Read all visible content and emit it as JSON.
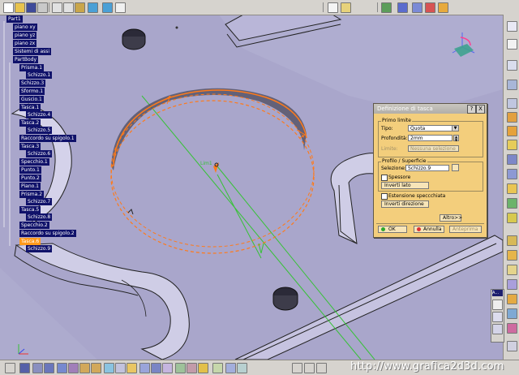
{
  "tree": {
    "nodes": [
      {
        "label": "Part1"
      },
      {
        "label": "piano xy"
      },
      {
        "label": "piano yz"
      },
      {
        "label": "piano zx"
      },
      {
        "label": "Sistemi di assi"
      },
      {
        "label": "PartBody"
      },
      {
        "label": "Prisma.1"
      },
      {
        "label": "Schizzo.1"
      },
      {
        "label": "Schizzo.3"
      },
      {
        "label": "Sformo.1"
      },
      {
        "label": "Guscio.1"
      },
      {
        "label": "Tasca.1"
      },
      {
        "label": "Schizzo.4"
      },
      {
        "label": "Tasca.2"
      },
      {
        "label": "Schizzo.5"
      },
      {
        "label": "Raccordo su spigolo.1"
      },
      {
        "label": "Tasca.3"
      },
      {
        "label": "Schizzo.6"
      },
      {
        "label": "Specchio.1"
      },
      {
        "label": "Punto.1"
      },
      {
        "label": "Punto.2"
      },
      {
        "label": "Piano.1"
      },
      {
        "label": "Prisma.2"
      },
      {
        "label": "Schizzo.7"
      },
      {
        "label": "Tasca.5"
      },
      {
        "label": "Schizzo.8"
      },
      {
        "label": "Specchio.2"
      },
      {
        "label": "Raccordo su spigolo.2"
      },
      {
        "label": "Tasca.6"
      },
      {
        "label": "Schizzo.9"
      }
    ]
  },
  "viewport": {
    "label_limit": "Lim1"
  },
  "dialog": {
    "title": "Definizione di tasca",
    "help_btn": "?",
    "close_btn": "X",
    "first_limit_group": "Primo limite",
    "type_label": "Tipo:",
    "type_value": "Quota",
    "depth_label": "Profondità:",
    "depth_value": "2mm",
    "limit_label": "Limite:",
    "limit_value": "Nessuna selezione",
    "profile_group": "Profilo / Superficie",
    "selection_label": "Selezione:",
    "selection_value": "Schizzo.9",
    "thickness_label": "Spessore",
    "reverse_side_btn": "Inverti lato",
    "mirror_ext_label": "Estensione speccchiata",
    "reverse_dir_btn": "Inverti direzione",
    "more_btn": "Altro>>",
    "ok_btn": "OK",
    "cancel_btn": "Annulla",
    "preview_btn": "Anteprima"
  },
  "palette": {
    "title": "A..."
  },
  "watermark": "http://www.grafica2d3d.com",
  "colors": {
    "viewport_bg": "#a9a6cb",
    "tree_node_bg": "#10126a",
    "tree_selected_bg": "#ff9a1c",
    "dialog_bg": "#f3ce7c",
    "sketch_orange": "#ff7a1a",
    "axis_green": "#36c236"
  }
}
